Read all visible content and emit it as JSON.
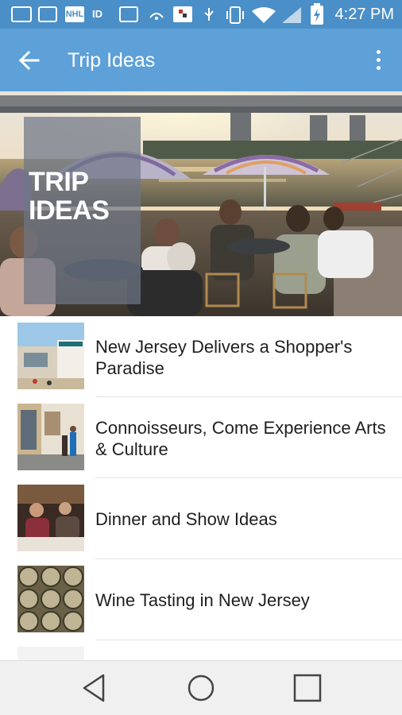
{
  "status_bar": {
    "time": "4:27 PM",
    "icons": [
      "message-icon",
      "image-icon",
      "nhl-icon",
      "id-icon",
      "notes-icon",
      "cast-icon",
      "game-icon",
      "usb-icon",
      "vibrate-icon",
      "wifi-icon",
      "signal-icon",
      "battery-charging-icon"
    ],
    "badge_nhl": "NHL",
    "badge_id": "ID"
  },
  "app_bar": {
    "title": "Trip Ideas",
    "back_icon": "arrow-back-icon",
    "menu_icon": "more-vert-icon",
    "color": "#5ea0d8",
    "status_color": "#4a8fc7"
  },
  "hero": {
    "badge_text": "TRIP\nIDEAS"
  },
  "items": [
    {
      "label": "New Jersey Delivers a Shopper's Paradise",
      "thumb": "outlet-mall-thumb"
    },
    {
      "label": "Connoisseurs, Come Experience Arts & Culture",
      "thumb": "art-gallery-thumb"
    },
    {
      "label": "Dinner and Show Ideas",
      "thumb": "dinner-show-thumb"
    },
    {
      "label": "Wine Tasting in New Jersey",
      "thumb": "wine-barrels-thumb"
    }
  ],
  "nav": {
    "back": "nav-back-icon",
    "home": "nav-home-icon",
    "recents": "nav-recents-icon"
  }
}
